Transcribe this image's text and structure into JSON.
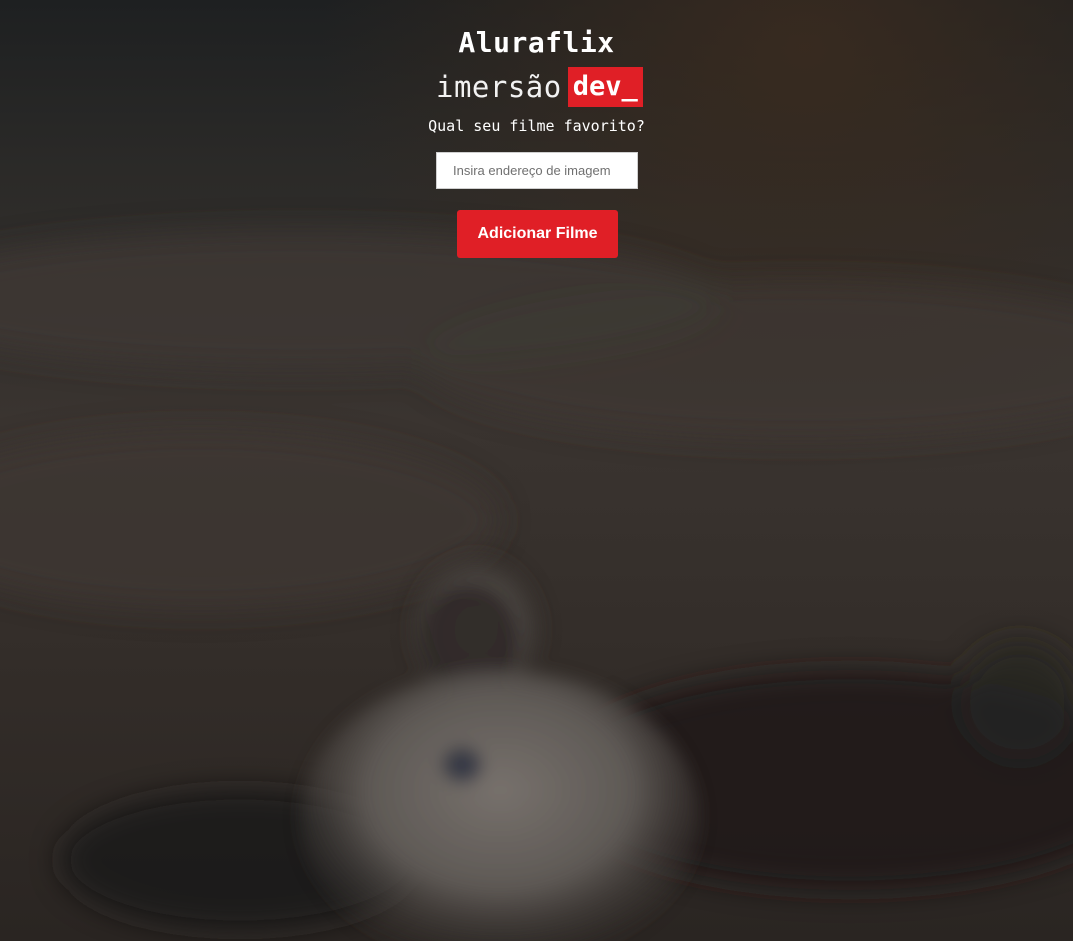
{
  "header": {
    "title": "Aluraflix",
    "logo_left": "imersão",
    "logo_right": "dev_"
  },
  "form": {
    "question": "Qual seu filme favorito?",
    "input_placeholder": "Insira endereço de imagem",
    "input_value": "",
    "add_button_label": "Adicionar Filme"
  },
  "background": {
    "description_icon": "astronaut-background-image",
    "overlay_color": "#2a2522"
  },
  "colors": {
    "accent": "#e01f26",
    "text": "#ffffff"
  }
}
